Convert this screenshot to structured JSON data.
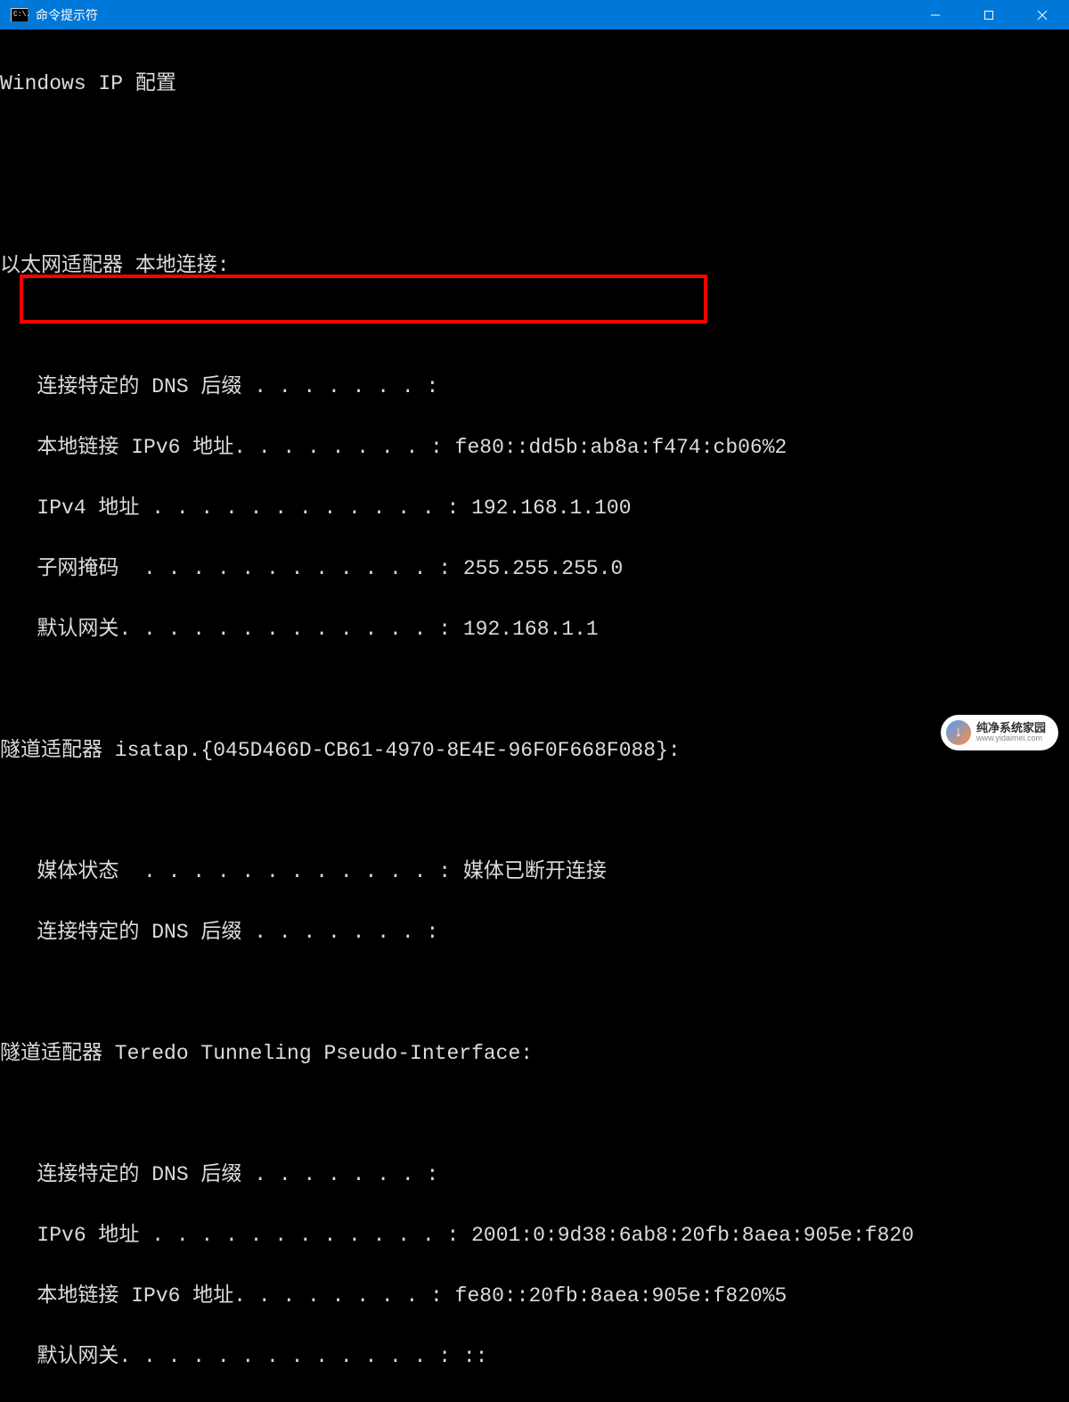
{
  "titlebar": {
    "icon_text": "C:\\.",
    "title": "命令提示符"
  },
  "terminal": {
    "header": "Windows IP 配置",
    "adapter1": {
      "title": "以太网适配器 本地连接:",
      "dns_suffix_label": "   连接特定的 DNS 后缀 . . . . . . . :",
      "ipv6_label": "   本地链接 IPv6 地址. . . . . . . . : ",
      "ipv6_value": "fe80::dd5b:ab8a:f474:cb06%2",
      "ipv4_label": "   IPv4 地址 . . . . . . . . . . . . : ",
      "ipv4_value": "192.168.1.100",
      "subnet_label": "   子网掩码  . . . . . . . . . . . . : ",
      "subnet_value": "255.255.255.0",
      "gateway_label": "   默认网关. . . . . . . . . . . . . : ",
      "gateway_value": "192.168.1.1"
    },
    "adapter2": {
      "title": "隧道适配器 isatap.{045D466D-CB61-4970-8E4E-96F0F668F088}:",
      "media_label": "   媒体状态  . . . . . . . . . . . . : ",
      "media_value": "媒体已断开连接",
      "dns_suffix_label": "   连接特定的 DNS 后缀 . . . . . . . :"
    },
    "adapter3": {
      "title": "隧道适配器 Teredo Tunneling Pseudo-Interface:",
      "dns_suffix_label": "   连接特定的 DNS 后缀 . . . . . . . :",
      "ipv6_label": "   IPv6 地址 . . . . . . . . . . . . : ",
      "ipv6_value": "2001:0:9d38:6ab8:20fb:8aea:905e:f820",
      "ipv6_local_label": "   本地链接 IPv6 地址. . . . . . . . : ",
      "ipv6_local_value": "fe80::20fb:8aea:905e:f820%5",
      "gateway_label": "   默认网关. . . . . . . . . . . . . : ::"
    }
  },
  "watermark": {
    "name": "纯净系统家园",
    "url": "www.yidaimei.com"
  }
}
